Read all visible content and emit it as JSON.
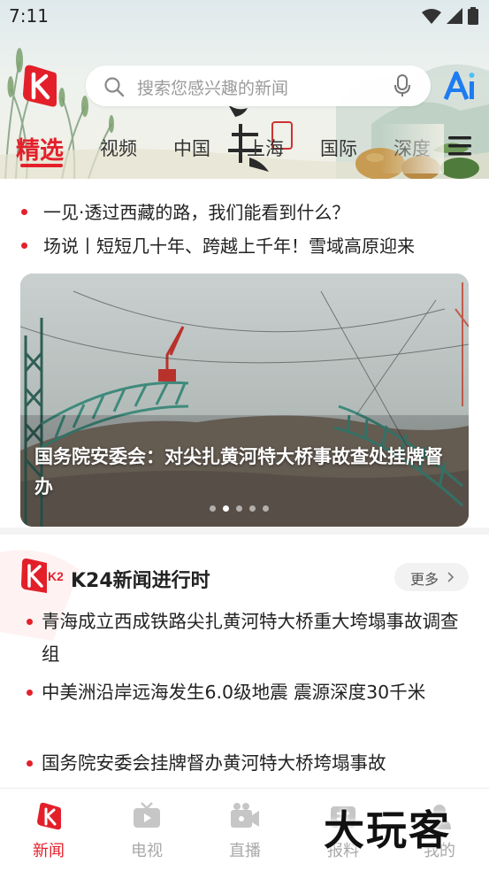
{
  "status_bar": {
    "time": "7:11"
  },
  "search": {
    "placeholder": "搜索您感兴趣的新闻"
  },
  "tabs": [
    {
      "label": "精选",
      "active": true
    },
    {
      "label": "视频"
    },
    {
      "label": "中国"
    },
    {
      "label": "上海"
    },
    {
      "label": "国际"
    },
    {
      "label": "深度"
    }
  ],
  "headlines": [
    "一见·透过西藏的路，我们能看到什么？",
    "场说丨短短几十年、跨越上千年！雪域高原迎来"
  ],
  "carousel": {
    "caption": "国务院安委会：对尖扎黄河特大桥事故查处挂牌督办",
    "slide_count": 5,
    "active_slide": 2
  },
  "k24": {
    "logo_text": "K24",
    "title": "K24新闻进行时",
    "more_label": "更多",
    "items": [
      "青海成立西成铁路尖扎黄河特大桥重大垮塌事故调查组",
      "中美洲沿岸远海发生6.0级地震 震源深度30千米",
      "国务院安委会挂牌督办黄河特大桥垮塌事故"
    ]
  },
  "bottom_nav": [
    {
      "label": "新闻",
      "active": true,
      "icon": "news-logo-icon"
    },
    {
      "label": "电视",
      "icon": "tv-icon"
    },
    {
      "label": "直播",
      "icon": "live-camera-icon"
    },
    {
      "label": "报料",
      "icon": "report-icon"
    },
    {
      "label": "我的",
      "icon": "profile-icon"
    }
  ],
  "watermark": "大玩客",
  "colors": {
    "accent": "#e3202a",
    "inactive": "#a9a9a9",
    "ai_blue": "#1e7cf2"
  }
}
